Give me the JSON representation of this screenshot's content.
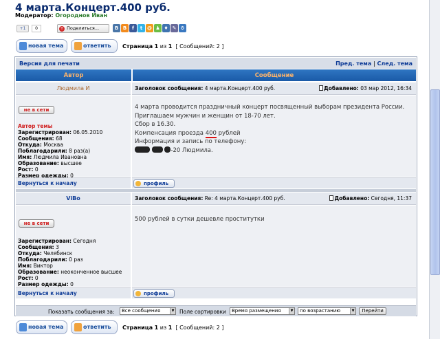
{
  "page": {
    "title": "4 марта.Концерт.400 руб.",
    "moderator_label": "Модератор:",
    "moderator_name": "Огороднов Иван"
  },
  "share": {
    "gplus_label": "+1",
    "gplus_count": "0",
    "share_button": "Поделиться...",
    "share_icon": "plus-icon",
    "networks": [
      {
        "name": "vk-icon",
        "glyph": "В",
        "color": "#4a76a8"
      },
      {
        "name": "blogger-icon",
        "glyph": "B",
        "color": "#f28b1e"
      },
      {
        "name": "facebook-icon",
        "glyph": "f",
        "color": "#3b5998"
      },
      {
        "name": "twitter-icon",
        "glyph": "t",
        "color": "#33b3e8"
      },
      {
        "name": "moimir-icon",
        "glyph": "@",
        "color": "#f19a1c"
      },
      {
        "name": "friends-icon",
        "glyph": "♟",
        "color": "#6cbd45"
      },
      {
        "name": "liveinternet-icon",
        "glyph": "♦",
        "color": "#3f74b0"
      },
      {
        "name": "bookmark-icon",
        "glyph": "✎",
        "color": "#6a6a9a"
      },
      {
        "name": "settings-icon",
        "glyph": "⚙",
        "color": "#3a78c0"
      }
    ]
  },
  "toolbar": {
    "new_topic": "новая тема",
    "reply": "ответить",
    "page_label": "Страница",
    "page_current": "1",
    "page_of": "из",
    "page_total": "1",
    "messages": "[ Сообщений: 2 ]"
  },
  "topic": {
    "print_version": "Версия для печати",
    "prev_topic": "Пред. тема",
    "next_topic": "След. тема",
    "separator": "|",
    "col_author": "Автор",
    "col_message": "Сообщение"
  },
  "posts": [
    {
      "author": "Людмила И",
      "subject_label": "Заголовок сообщения:",
      "subject": "4 марта.Концерт.400 руб.",
      "date_label": "Добавлено:",
      "date": "03 мар 2012, 16:34",
      "status": "не в сети",
      "starter": "Автор темы",
      "info": [
        {
          "k": "Зарегистрирован:",
          "v": "06.05.2010"
        },
        {
          "k": "Сообщения:",
          "v": "68"
        },
        {
          "k": "Откуда:",
          "v": "Москва"
        },
        {
          "k": "Поблагодарили:",
          "v": "8 раз(а)"
        },
        {
          "k": "Имя:",
          "v": "Людмила Ивановна"
        },
        {
          "k": "Образование:",
          "v": "высшее"
        },
        {
          "k": "Рост:",
          "v": "0"
        },
        {
          "k": "Размер одежды:",
          "v": "0"
        }
      ],
      "lines": [
        "4 марта проводится праздничный концерт посвященный выборам президента России.",
        "Приглашаем мужчин и женщин от 18-70 лет.",
        "Сбор в 16.30.",
        "Компенсация проезда",
        "Информация и запись по телефону:",
        "-20 Людмила."
      ],
      "price": "400",
      "price_suffix": "рублей",
      "back": "Вернуться к началу",
      "profile": "профиль"
    },
    {
      "author": "ViBo",
      "subject_label": "Заголовок сообщения:",
      "subject": "Re: 4 марта.Концерт.400 руб.",
      "date_label": "Добавлено:",
      "date": "Сегодня, 11:37",
      "status": "не в сети",
      "info": [
        {
          "k": "Зарегистрирован:",
          "v": "Сегодня"
        },
        {
          "k": "Сообщения:",
          "v": "3"
        },
        {
          "k": "Откуда:",
          "v": "Челябинск"
        },
        {
          "k": "Поблагодарили:",
          "v": "0 раз"
        },
        {
          "k": "Имя:",
          "v": "Виктор"
        },
        {
          "k": "Образование:",
          "v": "неоконченное высшее"
        },
        {
          "k": "Рост:",
          "v": "0"
        },
        {
          "k": "Размер одежды:",
          "v": "0"
        }
      ],
      "text": "500 рублей в сутки дешевле проститутки",
      "back": "Вернуться к началу",
      "profile": "профиль"
    }
  ],
  "sortbar": {
    "show_label": "Показать сообщения за:",
    "show_value": "Все сообщения",
    "sort_label": "Поле сортировки",
    "sort_value": "Время размещения",
    "order_value": "по возрастанию",
    "go": "Перейти"
  }
}
